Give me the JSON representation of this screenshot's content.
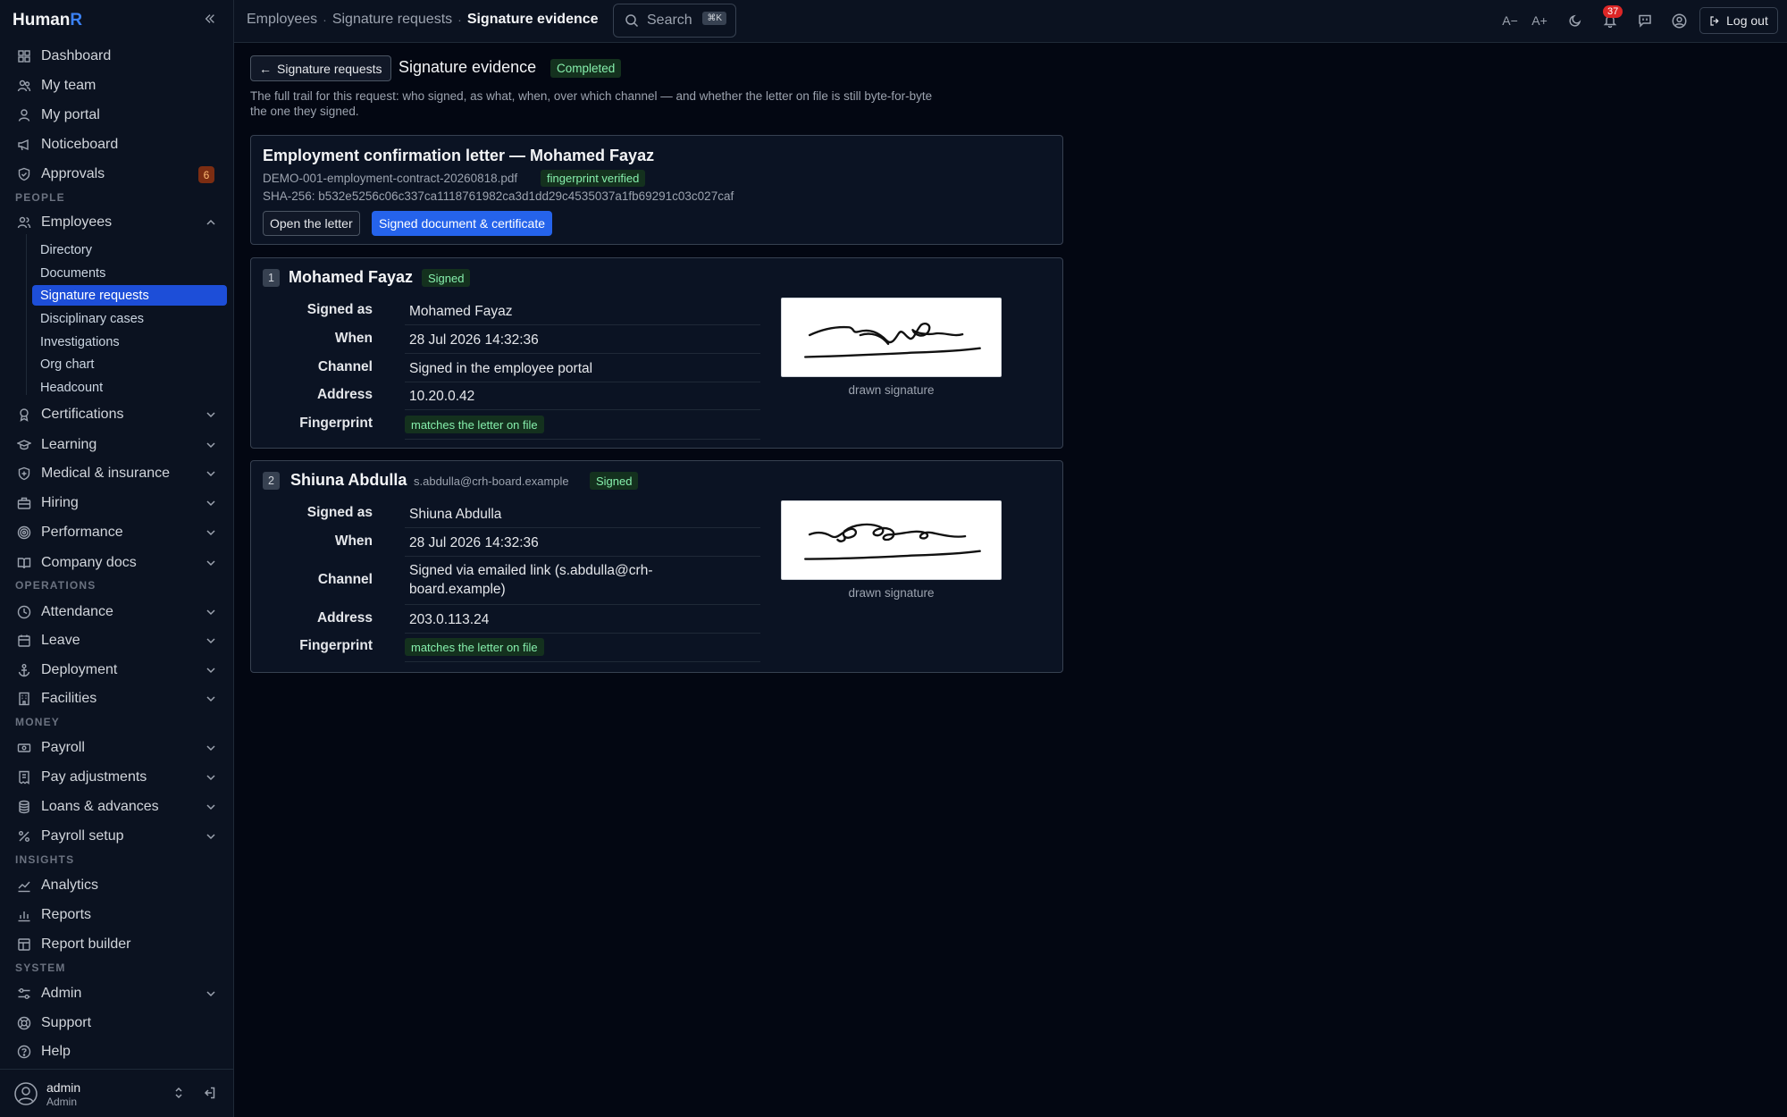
{
  "app": {
    "brand_main": "Human",
    "brand_accent": "R"
  },
  "sidebar": {
    "items": [
      {
        "label": "Dashboard",
        "icon": "dashboard-icon"
      },
      {
        "label": "My team",
        "icon": "team-icon"
      },
      {
        "label": "My portal",
        "icon": "user-icon"
      },
      {
        "label": "Noticeboard",
        "icon": "megaphone-icon"
      },
      {
        "label": "Approvals",
        "icon": "shield-check-icon",
        "badge": "6"
      }
    ],
    "sections": {
      "people": "PEOPLE",
      "operations": "OPERATIONS",
      "money": "MONEY",
      "insights": "INSIGHTS",
      "system": "SYSTEM"
    },
    "employees": {
      "label": "Employees",
      "subitems": [
        "Directory",
        "Documents",
        "Signature requests",
        "Disciplinary cases",
        "Investigations",
        "Org chart",
        "Headcount"
      ],
      "active": "Signature requests"
    },
    "people_groups": [
      "Certifications",
      "Learning",
      "Medical & insurance",
      "Hiring",
      "Performance",
      "Company docs"
    ],
    "operations_groups": [
      "Attendance",
      "Leave",
      "Deployment",
      "Facilities"
    ],
    "money_groups": [
      "Payroll",
      "Pay adjustments",
      "Loans & advances",
      "Payroll setup"
    ],
    "insights_items": [
      "Analytics",
      "Reports",
      "Report builder"
    ],
    "system_items": [
      "Admin",
      "Support",
      "Help"
    ],
    "user": {
      "name": "admin",
      "role": "Admin"
    }
  },
  "topbar": {
    "breadcrumb": [
      "Employees",
      "Signature requests",
      "Signature evidence"
    ],
    "search_label": "Search",
    "search_shortcut": "⌘K",
    "font_decrease": "A−",
    "font_increase": "A+",
    "notifications_count": "37",
    "logout_label": "Log out"
  },
  "page": {
    "back_label": "Signature requests",
    "title": "Signature evidence",
    "status": "Completed",
    "intro": "The full trail for this request: who signed, as what, when, over which channel — and whether the letter on file is still byte-for-byte the one they signed."
  },
  "document": {
    "title": "Employment confirmation letter — Mohamed Fayaz",
    "filename": "DEMO-001-employment-contract-20260818.pdf",
    "fingerprint_badge": "fingerprint verified",
    "hash": "SHA-256: b532e5256c06c337ca1118761982ca3d1dd29c4535037a1fb69291c03c027caf",
    "open_label": "Open the letter",
    "signed_label": "Signed document & certificate"
  },
  "field_labels": {
    "signed_as": "Signed as",
    "when": "When",
    "channel": "Channel",
    "address": "Address",
    "fingerprint": "Fingerprint"
  },
  "signers": [
    {
      "index": "1",
      "name": "Mohamed Fayaz",
      "email": "",
      "status": "Signed",
      "signed_as": "Mohamed Fayaz",
      "when": "28 Jul 2026 14:32:36",
      "channel": "Signed in the employee portal",
      "address": "10.20.0.42",
      "fingerprint": "matches the letter on file",
      "signature_caption": "drawn signature"
    },
    {
      "index": "2",
      "name": "Shiuna Abdulla",
      "email": "s.abdulla@crh-board.example",
      "status": "Signed",
      "signed_as": "Shiuna Abdulla",
      "when": "28 Jul 2026 14:32:36",
      "channel": "Signed via emailed link (s.abdulla@crh-board.example)",
      "address": "203.0.113.24",
      "fingerprint": "matches the letter on file",
      "signature_caption": "drawn signature"
    }
  ],
  "colors": {
    "background": "#030712",
    "sidebar": "#0b1220",
    "accent": "#2563eb",
    "success_bg": "#14311e",
    "success_text": "#86efac",
    "notification": "#dc2626"
  }
}
